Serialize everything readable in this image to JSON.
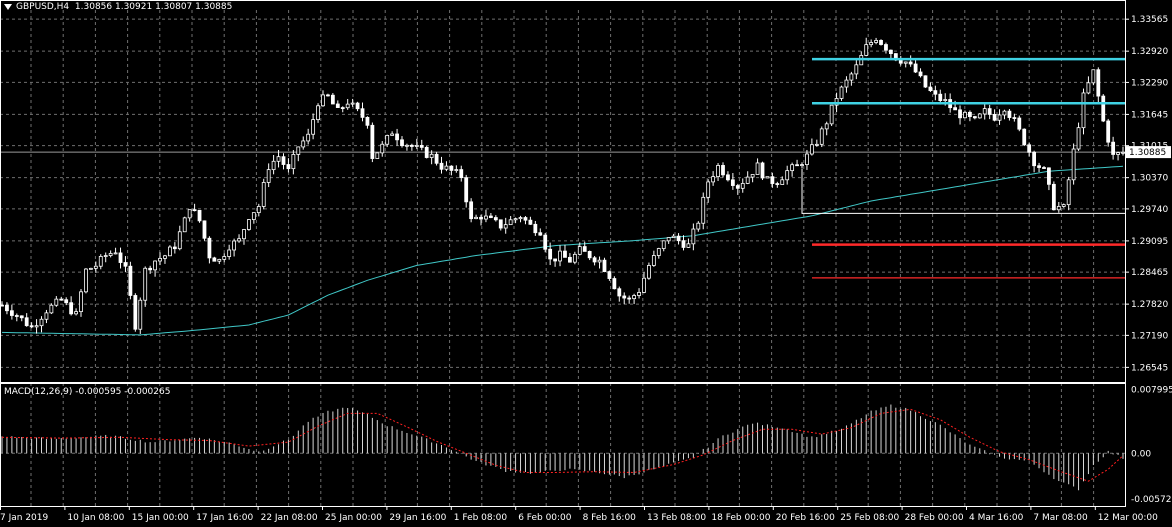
{
  "header": {
    "symbol": "GBPUSD,H4",
    "ohlc": "1.30856 1.30921 1.30807 1.30885"
  },
  "macd_header": {
    "title": "MACD(12,26,9) -0.000595 -0.000265"
  },
  "colors": {
    "background": "#000000",
    "grid": "#6f6f6f",
    "candle": "#ffffff",
    "ma": "#40c8c8",
    "resistance": "#3fd2e4",
    "support": "#ff2a2a",
    "box": "#ffffff",
    "macd_hist": "#d8d8d8",
    "macd_signal": "#ff2020"
  },
  "chart_data": [
    {
      "type": "candlestick",
      "symbol": "GBPUSD",
      "timeframe": "H4",
      "ylim": [
        1.2625,
        1.3375
      ],
      "y_ticks": [
        "1.33565",
        "1.32920",
        "1.32290",
        "1.31645",
        "1.31015",
        "1.30370",
        "1.29740",
        "1.29095",
        "1.28465",
        "1.27820",
        "1.27190",
        "1.26545"
      ],
      "current_price": "1.30885",
      "x_ticks": [
        "7 Jan 2019",
        "10 Jan 08:00",
        "15 Jan 00:00",
        "17 Jan 16:00",
        "22 Jan 08:00",
        "25 Jan 00:00",
        "29 Jan 16:00",
        "1 Feb 08:00",
        "6 Feb 00:00",
        "8 Feb 16:00",
        "13 Feb 08:00",
        "18 Feb 00:00",
        "20 Feb 16:00",
        "25 Feb 08:00",
        "28 Feb 00:00",
        "4 Mar 16:00",
        "7 Mar 08:00",
        "12 Mar 00:00"
      ],
      "close_path": [
        [
          0,
          1.278
        ],
        [
          3,
          1.276
        ],
        [
          6,
          1.2735
        ],
        [
          9,
          1.277
        ],
        [
          12,
          1.279
        ],
        [
          15,
          1.276
        ],
        [
          17,
          1.285
        ],
        [
          19,
          1.286
        ],
        [
          21,
          1.288
        ],
        [
          23,
          1.289
        ],
        [
          25,
          1.285
        ],
        [
          27,
          1.274
        ],
        [
          29,
          1.285
        ],
        [
          31,
          1.287
        ],
        [
          33,
          1.288
        ],
        [
          35,
          1.29
        ],
        [
          37,
          1.295
        ],
        [
          38,
          1.298
        ],
        [
          40,
          1.295
        ],
        [
          42,
          1.288
        ],
        [
          44,
          1.287
        ],
        [
          46,
          1.29
        ],
        [
          48,
          1.291
        ],
        [
          50,
          1.296
        ],
        [
          52,
          1.298
        ],
        [
          54,
          1.306
        ],
        [
          56,
          1.308
        ],
        [
          58,
          1.305
        ],
        [
          60,
          1.31
        ],
        [
          62,
          1.312
        ],
        [
          64,
          1.319
        ],
        [
          66,
          1.32
        ],
        [
          68,
          1.317
        ],
        [
          70,
          1.319
        ],
        [
          72,
          1.317
        ],
        [
          74,
          1.315
        ],
        [
          75,
          1.308
        ],
        [
          77,
          1.31
        ],
        [
          79,
          1.313
        ],
        [
          81,
          1.311
        ],
        [
          83,
          1.31
        ],
        [
          85,
          1.309
        ],
        [
          87,
          1.308
        ],
        [
          89,
          1.306
        ],
        [
          91,
          1.305
        ],
        [
          93,
          1.304
        ],
        [
          95,
          1.295
        ],
        [
          97,
          1.296
        ],
        [
          99,
          1.295
        ],
        [
          101,
          1.294
        ],
        [
          103,
          1.295
        ],
        [
          105,
          1.296
        ],
        [
          107,
          1.294
        ],
        [
          109,
          1.293
        ],
        [
          111,
          1.287
        ],
        [
          113,
          1.288
        ],
        [
          115,
          1.287
        ],
        [
          117,
          1.289
        ],
        [
          119,
          1.288
        ],
        [
          121,
          1.287
        ],
        [
          123,
          1.284
        ],
        [
          125,
          1.28
        ],
        [
          127,
          1.279
        ],
        [
          129,
          1.281
        ],
        [
          131,
          1.286
        ],
        [
          133,
          1.289
        ],
        [
          135,
          1.292
        ],
        [
          137,
          1.291
        ],
        [
          139,
          1.29
        ],
        [
          141,
          1.295
        ],
        [
          143,
          1.303
        ],
        [
          145,
          1.306
        ],
        [
          147,
          1.304
        ],
        [
          149,
          1.302
        ],
        [
          151,
          1.304
        ],
        [
          153,
          1.306
        ],
        [
          155,
          1.303
        ],
        [
          157,
          1.303
        ],
        [
          159,
          1.305
        ],
        [
          161,
          1.306
        ],
        [
          163,
          1.308
        ],
        [
          165,
          1.311
        ],
        [
          167,
          1.315
        ],
        [
          169,
          1.32
        ],
        [
          171,
          1.323
        ],
        [
          173,
          1.326
        ],
        [
          175,
          1.33
        ],
        [
          177,
          1.332
        ],
        [
          179,
          1.33
        ],
        [
          181,
          1.328
        ],
        [
          183,
          1.327
        ],
        [
          185,
          1.325
        ],
        [
          187,
          1.322
        ],
        [
          189,
          1.32
        ],
        [
          191,
          1.319
        ],
        [
          193,
          1.317
        ],
        [
          195,
          1.316
        ],
        [
          197,
          1.315
        ],
        [
          199,
          1.317
        ],
        [
          201,
          1.316
        ],
        [
          203,
          1.318
        ],
        [
          205,
          1.315
        ],
        [
          207,
          1.311
        ],
        [
          209,
          1.307
        ],
        [
          211,
          1.305
        ],
        [
          213,
          1.298
        ],
        [
          215,
          1.2975
        ],
        [
          217,
          1.309
        ],
        [
          219,
          1.32
        ],
        [
          221,
          1.325
        ],
        [
          223,
          1.315
        ],
        [
          225,
          1.308
        ],
        [
          227,
          1.3088
        ]
      ],
      "ma_path": [
        [
          0,
          1.2725
        ],
        [
          28,
          1.272
        ],
        [
          40,
          1.273
        ],
        [
          50,
          1.274
        ],
        [
          58,
          1.276
        ],
        [
          66,
          1.28
        ],
        [
          74,
          1.283
        ],
        [
          84,
          1.286
        ],
        [
          96,
          1.288
        ],
        [
          112,
          1.29
        ],
        [
          128,
          1.291
        ],
        [
          140,
          1.292
        ],
        [
          152,
          1.294
        ],
        [
          164,
          1.296
        ],
        [
          176,
          1.299
        ],
        [
          188,
          1.301
        ],
        [
          200,
          1.303
        ],
        [
          212,
          1.305
        ],
        [
          227,
          1.306
        ]
      ],
      "resistance_lines": [
        1.3276,
        1.3187
      ],
      "support_lines": [
        1.2902,
        1.2835
      ],
      "range_box": {
        "from": 162,
        "to": 227,
        "high": 1.3055,
        "low": 1.2965
      }
    },
    {
      "type": "macd",
      "params": "12,26,9",
      "ylim": [
        -0.0061,
        0.0083
      ],
      "y_ticks": [
        "0.007995",
        "0.00",
        "-0.005727"
      ],
      "histogram_path": [
        [
          0,
          0.0021
        ],
        [
          10,
          0.0018
        ],
        [
          22,
          0.0022
        ],
        [
          30,
          0.0014
        ],
        [
          34,
          0.0016
        ],
        [
          40,
          0.002
        ],
        [
          46,
          0.0013
        ],
        [
          52,
          0.0002
        ],
        [
          58,
          0.0017
        ],
        [
          62,
          0.004
        ],
        [
          66,
          0.0052
        ],
        [
          70,
          0.0058
        ],
        [
          74,
          0.0048
        ],
        [
          78,
          0.0035
        ],
        [
          84,
          0.0022
        ],
        [
          90,
          0.0008
        ],
        [
          96,
          -0.001
        ],
        [
          102,
          -0.0022
        ],
        [
          108,
          -0.0025
        ],
        [
          114,
          -0.002
        ],
        [
          120,
          -0.0023
        ],
        [
          126,
          -0.003
        ],
        [
          132,
          -0.002
        ],
        [
          140,
          -0.0005
        ],
        [
          146,
          0.0022
        ],
        [
          152,
          0.0038
        ],
        [
          158,
          0.0032
        ],
        [
          164,
          0.002
        ],
        [
          170,
          0.003
        ],
        [
          176,
          0.0052
        ],
        [
          180,
          0.006
        ],
        [
          184,
          0.0054
        ],
        [
          190,
          0.0035
        ],
        [
          196,
          0.001
        ],
        [
          202,
          -0.0005
        ],
        [
          208,
          -0.001
        ],
        [
          214,
          -0.0035
        ],
        [
          218,
          -0.0045
        ],
        [
          221,
          -0.0015
        ],
        [
          224,
          0.0002
        ],
        [
          227,
          -0.0006
        ]
      ],
      "signal_path": [
        [
          0,
          0.002
        ],
        [
          12,
          0.0019
        ],
        [
          24,
          0.002
        ],
        [
          34,
          0.0017
        ],
        [
          42,
          0.0016
        ],
        [
          50,
          0.0009
        ],
        [
          58,
          0.0014
        ],
        [
          64,
          0.0034
        ],
        [
          70,
          0.005
        ],
        [
          76,
          0.005
        ],
        [
          82,
          0.0033
        ],
        [
          88,
          0.0015
        ],
        [
          94,
          0.0
        ],
        [
          100,
          -0.0015
        ],
        [
          106,
          -0.0024
        ],
        [
          112,
          -0.0024
        ],
        [
          120,
          -0.0023
        ],
        [
          128,
          -0.0024
        ],
        [
          136,
          -0.0014
        ],
        [
          142,
          -0.0002
        ],
        [
          148,
          0.0016
        ],
        [
          154,
          0.003
        ],
        [
          160,
          0.003
        ],
        [
          166,
          0.0024
        ],
        [
          172,
          0.0032
        ],
        [
          178,
          0.005
        ],
        [
          184,
          0.0055
        ],
        [
          190,
          0.0042
        ],
        [
          196,
          0.002
        ],
        [
          202,
          0.0002
        ],
        [
          208,
          -0.0008
        ],
        [
          214,
          -0.0022
        ],
        [
          220,
          -0.0035
        ],
        [
          224,
          -0.002
        ],
        [
          227,
          -0.0003
        ]
      ]
    }
  ]
}
